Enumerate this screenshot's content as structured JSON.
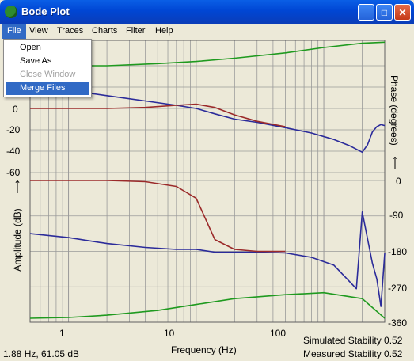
{
  "window": {
    "title": "Bode Plot"
  },
  "menu": {
    "items": [
      "File",
      "View",
      "Traces",
      "Charts",
      "Filter",
      "Help"
    ],
    "active": "File",
    "file_menu": [
      {
        "label": "Open",
        "enabled": true,
        "highlighted": false
      },
      {
        "label": "Save As",
        "enabled": true,
        "highlighted": false
      },
      {
        "label": "Close Window",
        "enabled": false,
        "highlighted": false
      },
      {
        "label": "Merge Files",
        "enabled": true,
        "highlighted": true
      }
    ]
  },
  "status": {
    "cursor": "1.88 Hz, 61.05 dB",
    "simulated": "Simulated Stability 0.52",
    "measured": "Measured Stability 0.52"
  },
  "colors": {
    "gain_measured": "#2b2b9a",
    "gain_simulated": "#9b2a2a",
    "phase": "#1f9a1f",
    "grid": "#9a9a9a",
    "background": "#ece9d8"
  },
  "chart_data": {
    "type": "line",
    "xlabel": "Frequency (Hz)",
    "x_scale": "log",
    "x_ticks": [
      "1",
      "10",
      "100"
    ],
    "xlim": [
      0.5,
      300
    ],
    "amplitude_axis": {
      "label": "Amplitude (dB)",
      "ticks": [
        "0",
        "-20",
        "-40",
        "-60"
      ]
    },
    "phase_axis": {
      "label": "Phase (degrees)",
      "ticks": [
        "0",
        "-90",
        "-180",
        "-270",
        "-360"
      ]
    },
    "grid": true,
    "series": [
      {
        "axis": "amplitude",
        "color": "#2b2b9a",
        "x": [
          0.5,
          1,
          2,
          4,
          7,
          10,
          14,
          20,
          30,
          50,
          80,
          120,
          160,
          200,
          220,
          240,
          260,
          280,
          300
        ],
        "y": [
          20,
          17,
          12,
          7,
          3,
          0,
          -5,
          -10,
          -13,
          -18,
          -23,
          -29,
          -35,
          -41,
          -34,
          -22,
          -17,
          -15,
          -16
        ]
      },
      {
        "axis": "amplitude",
        "color": "#9b2a2a",
        "x": [
          0.5,
          1,
          2,
          4,
          7,
          10,
          14,
          20,
          30,
          50
        ],
        "y": [
          0,
          0,
          0,
          1,
          3,
          4,
          1,
          -6,
          -12,
          -17
        ]
      },
      {
        "axis": "phase",
        "color": "#2b2b9a",
        "x": [
          0.5,
          1,
          2,
          4,
          7,
          10,
          14,
          20,
          30,
          50,
          80,
          120,
          180,
          200,
          240,
          260,
          280,
          300
        ],
        "y": [
          -135,
          -145,
          -160,
          -170,
          -175,
          -175,
          -182,
          -182,
          -182,
          -184,
          -195,
          -215,
          -275,
          -80,
          -210,
          -250,
          -320,
          -185
        ]
      },
      {
        "axis": "phase",
        "color": "#9b2a2a",
        "x": [
          0.5,
          1,
          2,
          4,
          7,
          10,
          14,
          20,
          30,
          50
        ],
        "y": [
          0,
          0,
          0,
          -3,
          -15,
          -45,
          -150,
          -175,
          -180,
          -180
        ]
      },
      {
        "axis": "phase",
        "color": "#1f9a1f",
        "x": [
          0.5,
          1,
          2,
          5,
          10,
          20,
          50,
          100,
          200,
          300
        ],
        "y": [
          -350,
          -348,
          -342,
          -330,
          -315,
          -300,
          -290,
          -285,
          -300,
          -350
        ]
      },
      {
        "axis": "amplitude",
        "color": "#1f9a1f",
        "x": [
          0.5,
          1,
          2,
          5,
          10,
          20,
          50,
          100,
          200,
          300
        ],
        "y": [
          40,
          40,
          40,
          42,
          44,
          47,
          52,
          57,
          61,
          62
        ]
      }
    ]
  }
}
